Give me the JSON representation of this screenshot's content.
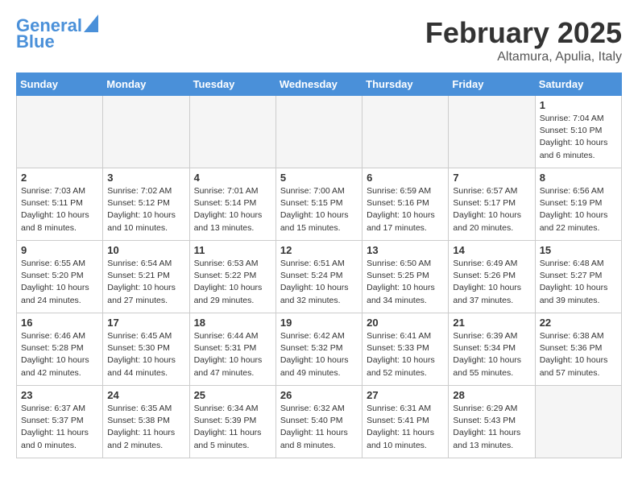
{
  "header": {
    "logo_line1": "General",
    "logo_line2": "Blue",
    "title": "February 2025",
    "subtitle": "Altamura, Apulia, Italy"
  },
  "weekdays": [
    "Sunday",
    "Monday",
    "Tuesday",
    "Wednesday",
    "Thursday",
    "Friday",
    "Saturday"
  ],
  "weeks": [
    [
      {
        "day": "",
        "info": ""
      },
      {
        "day": "",
        "info": ""
      },
      {
        "day": "",
        "info": ""
      },
      {
        "day": "",
        "info": ""
      },
      {
        "day": "",
        "info": ""
      },
      {
        "day": "",
        "info": ""
      },
      {
        "day": "1",
        "info": "Sunrise: 7:04 AM\nSunset: 5:10 PM\nDaylight: 10 hours\nand 6 minutes."
      }
    ],
    [
      {
        "day": "2",
        "info": "Sunrise: 7:03 AM\nSunset: 5:11 PM\nDaylight: 10 hours\nand 8 minutes."
      },
      {
        "day": "3",
        "info": "Sunrise: 7:02 AM\nSunset: 5:12 PM\nDaylight: 10 hours\nand 10 minutes."
      },
      {
        "day": "4",
        "info": "Sunrise: 7:01 AM\nSunset: 5:14 PM\nDaylight: 10 hours\nand 13 minutes."
      },
      {
        "day": "5",
        "info": "Sunrise: 7:00 AM\nSunset: 5:15 PM\nDaylight: 10 hours\nand 15 minutes."
      },
      {
        "day": "6",
        "info": "Sunrise: 6:59 AM\nSunset: 5:16 PM\nDaylight: 10 hours\nand 17 minutes."
      },
      {
        "day": "7",
        "info": "Sunrise: 6:57 AM\nSunset: 5:17 PM\nDaylight: 10 hours\nand 20 minutes."
      },
      {
        "day": "8",
        "info": "Sunrise: 6:56 AM\nSunset: 5:19 PM\nDaylight: 10 hours\nand 22 minutes."
      }
    ],
    [
      {
        "day": "9",
        "info": "Sunrise: 6:55 AM\nSunset: 5:20 PM\nDaylight: 10 hours\nand 24 minutes."
      },
      {
        "day": "10",
        "info": "Sunrise: 6:54 AM\nSunset: 5:21 PM\nDaylight: 10 hours\nand 27 minutes."
      },
      {
        "day": "11",
        "info": "Sunrise: 6:53 AM\nSunset: 5:22 PM\nDaylight: 10 hours\nand 29 minutes."
      },
      {
        "day": "12",
        "info": "Sunrise: 6:51 AM\nSunset: 5:24 PM\nDaylight: 10 hours\nand 32 minutes."
      },
      {
        "day": "13",
        "info": "Sunrise: 6:50 AM\nSunset: 5:25 PM\nDaylight: 10 hours\nand 34 minutes."
      },
      {
        "day": "14",
        "info": "Sunrise: 6:49 AM\nSunset: 5:26 PM\nDaylight: 10 hours\nand 37 minutes."
      },
      {
        "day": "15",
        "info": "Sunrise: 6:48 AM\nSunset: 5:27 PM\nDaylight: 10 hours\nand 39 minutes."
      }
    ],
    [
      {
        "day": "16",
        "info": "Sunrise: 6:46 AM\nSunset: 5:28 PM\nDaylight: 10 hours\nand 42 minutes."
      },
      {
        "day": "17",
        "info": "Sunrise: 6:45 AM\nSunset: 5:30 PM\nDaylight: 10 hours\nand 44 minutes."
      },
      {
        "day": "18",
        "info": "Sunrise: 6:44 AM\nSunset: 5:31 PM\nDaylight: 10 hours\nand 47 minutes."
      },
      {
        "day": "19",
        "info": "Sunrise: 6:42 AM\nSunset: 5:32 PM\nDaylight: 10 hours\nand 49 minutes."
      },
      {
        "day": "20",
        "info": "Sunrise: 6:41 AM\nSunset: 5:33 PM\nDaylight: 10 hours\nand 52 minutes."
      },
      {
        "day": "21",
        "info": "Sunrise: 6:39 AM\nSunset: 5:34 PM\nDaylight: 10 hours\nand 55 minutes."
      },
      {
        "day": "22",
        "info": "Sunrise: 6:38 AM\nSunset: 5:36 PM\nDaylight: 10 hours\nand 57 minutes."
      }
    ],
    [
      {
        "day": "23",
        "info": "Sunrise: 6:37 AM\nSunset: 5:37 PM\nDaylight: 11 hours\nand 0 minutes."
      },
      {
        "day": "24",
        "info": "Sunrise: 6:35 AM\nSunset: 5:38 PM\nDaylight: 11 hours\nand 2 minutes."
      },
      {
        "day": "25",
        "info": "Sunrise: 6:34 AM\nSunset: 5:39 PM\nDaylight: 11 hours\nand 5 minutes."
      },
      {
        "day": "26",
        "info": "Sunrise: 6:32 AM\nSunset: 5:40 PM\nDaylight: 11 hours\nand 8 minutes."
      },
      {
        "day": "27",
        "info": "Sunrise: 6:31 AM\nSunset: 5:41 PM\nDaylight: 11 hours\nand 10 minutes."
      },
      {
        "day": "28",
        "info": "Sunrise: 6:29 AM\nSunset: 5:43 PM\nDaylight: 11 hours\nand 13 minutes."
      },
      {
        "day": "",
        "info": ""
      }
    ]
  ]
}
